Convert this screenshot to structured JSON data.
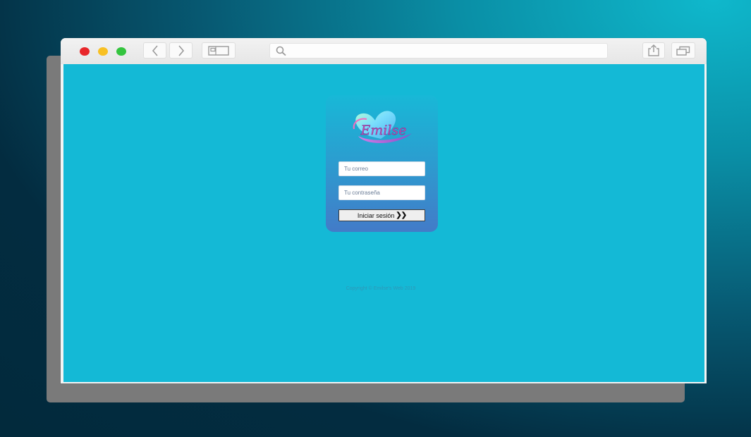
{
  "browser": {
    "traffic_lights": [
      "close",
      "minimize",
      "maximize"
    ],
    "nav_icons": {
      "back": "chevron-left-icon",
      "forward": "chevron-right-icon",
      "sidebar": "sidebar-icon",
      "search": "search-icon",
      "share": "share-icon",
      "tabs": "tabs-icon"
    },
    "address_bar_value": ""
  },
  "login": {
    "logo_text": "Emilse",
    "email_placeholder": "Tu correo",
    "password_placeholder": "Tu contraseña",
    "submit_label": "Iniciar sesión",
    "submit_icon": "double-chevron-right-icon"
  },
  "footer": {
    "copyright": "Copyright © Emilse's Web 2019"
  },
  "colors": {
    "page_background": "#14b9d6",
    "card_top": "#18b8d7",
    "card_bottom": "#437bc8",
    "close": "#e8262a",
    "minimize": "#f8c023",
    "maximize": "#33c43e"
  }
}
